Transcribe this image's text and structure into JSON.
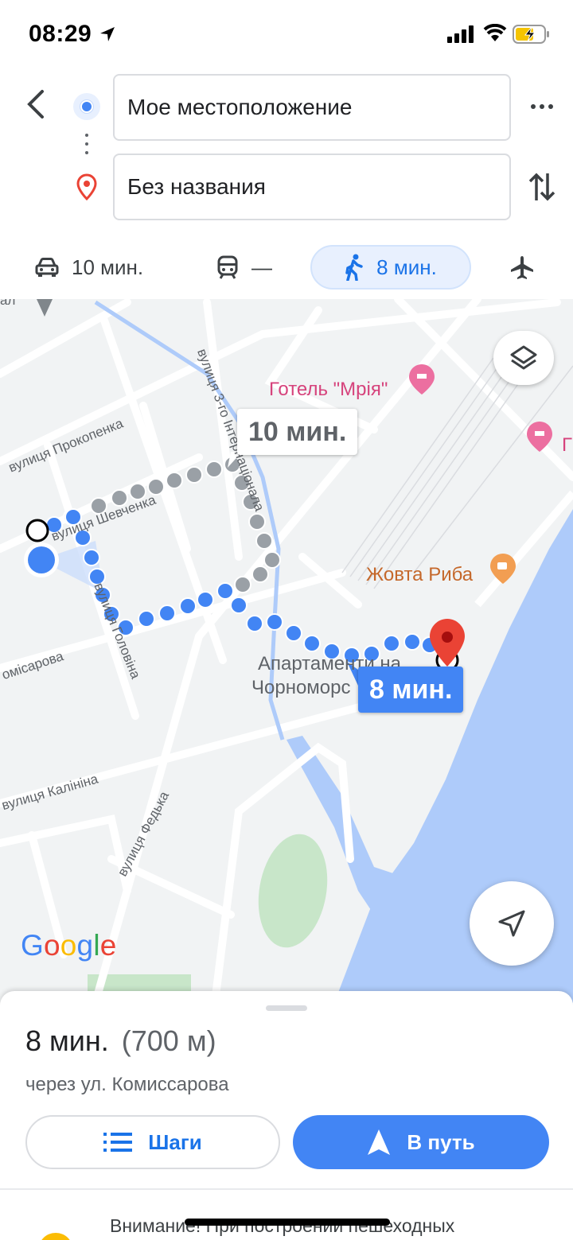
{
  "status_bar": {
    "time": "08:29"
  },
  "header": {
    "origin": "Мое местоположение",
    "destination": "Без названия"
  },
  "modes": {
    "drive": "10 мин.",
    "transit": "—",
    "walk": "8 мин."
  },
  "map": {
    "alt_route_time": "10 мин.",
    "main_route_time": "8 мин.",
    "poi_hotel_1": "Готель \"Мрія\"",
    "poi_hotel_2": "Г",
    "poi_food": "Жовта Риба",
    "poi_apartments_line1": "Апартаменти на",
    "poi_apartments_line2": "Чорноморс",
    "streets": {
      "prokopenka": "вулиця Прокопенка",
      "shevchenka": "вулиця Шевченка",
      "holovina": "вулиця Головіна",
      "komisarova": "омісарова",
      "kalinina": "вулиця Калініна",
      "fedka": "вулиця Федька",
      "natsionala": "вулиця 3-го Інтернаціонала",
      "top_left": "ал"
    },
    "google": "Google"
  },
  "sheet": {
    "time": "8 мин.",
    "distance": "(700 м)",
    "via": "через ул. Комиссарова",
    "steps_label": "Шаги",
    "start_label": "В путь",
    "warning": "Внимание! При построении пешеходных"
  },
  "colors": {
    "accent": "#4285f4",
    "water": "#aecbfa",
    "park": "#c8e6c9",
    "road": "#ffffff",
    "route_alt": "#9aa0a6"
  },
  "icons": {
    "back": "chevron-left-icon",
    "origin": "my-location-dot-icon",
    "destination": "place-pin-icon",
    "more": "more-horizontal-icon",
    "swap": "swap-vertical-icon",
    "drive": "car-icon",
    "transit": "train-icon",
    "walk": "walk-icon",
    "flight": "airplane-icon",
    "layers": "layers-icon",
    "recenter": "navigation-arrow-icon",
    "steps": "list-icon",
    "start": "navigation-arrow-icon"
  }
}
